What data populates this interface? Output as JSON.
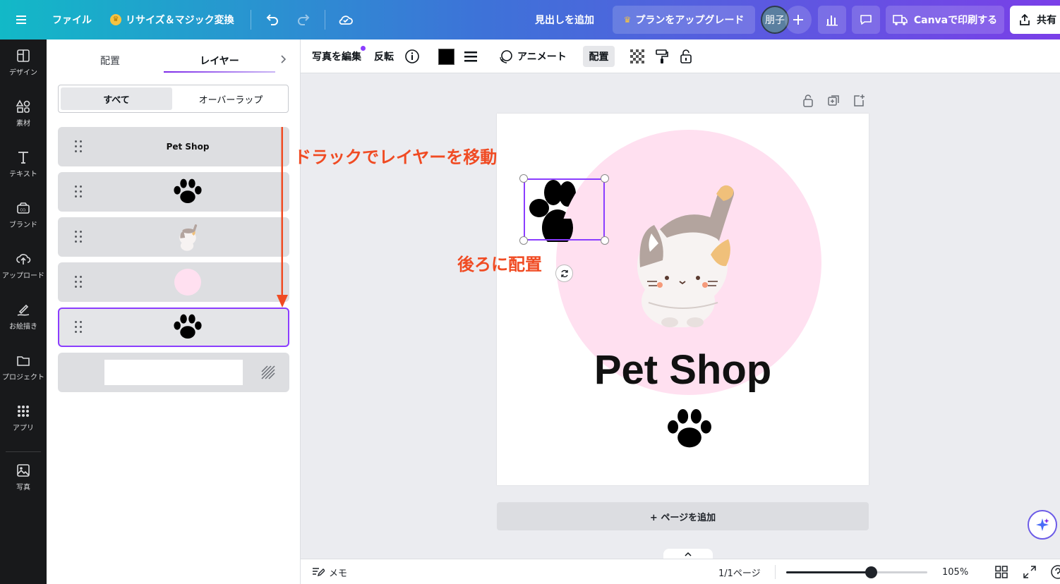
{
  "topbar": {
    "file_label": "ファイル",
    "resize_label": "リサイズ＆マジック変換",
    "add_heading_label": "見出しを追加",
    "upgrade_label": "プランをアップグレード",
    "avatar_label": "朋子",
    "print_label": "Canvaで印刷する",
    "share_label": "共有"
  },
  "rail": {
    "items": [
      {
        "label": "デザイン",
        "icon": "design-icon"
      },
      {
        "label": "素材",
        "icon": "elements-icon"
      },
      {
        "label": "テキスト",
        "icon": "text-icon"
      },
      {
        "label": "ブランド",
        "icon": "brand-icon"
      },
      {
        "label": "アップロード",
        "icon": "upload-icon"
      },
      {
        "label": "お絵描き",
        "icon": "draw-icon"
      },
      {
        "label": "プロジェクト",
        "icon": "folder-icon"
      },
      {
        "label": "アプリ",
        "icon": "apps-icon"
      },
      {
        "label": "写真",
        "icon": "photo-icon"
      }
    ]
  },
  "panel": {
    "tab_arrange": "配置",
    "tab_layers": "レイヤー",
    "filter_all": "すべて",
    "filter_overlap": "オーバーラップ",
    "layers": [
      {
        "kind": "text",
        "text": "Pet Shop"
      },
      {
        "kind": "paw"
      },
      {
        "kind": "cat"
      },
      {
        "kind": "circle"
      },
      {
        "kind": "paw",
        "selected": true
      },
      {
        "kind": "background"
      }
    ]
  },
  "toolbar": {
    "edit_photo": "写真を編集",
    "flip": "反転",
    "animate": "アニメート",
    "position": "配置",
    "color": "#000000"
  },
  "canvas": {
    "title": "Pet Shop",
    "circle_color": "#ffe0f0",
    "add_page_label": "+ ページを追加"
  },
  "annotations": {
    "drag_text": "ドラックでレイヤーを移動",
    "back_text": "後ろに配置",
    "color": "#f04b23"
  },
  "bottombar": {
    "notes_label": "メモ",
    "page_indicator": "1/1ページ",
    "zoom": "105%",
    "zoom_level": 0.6
  }
}
